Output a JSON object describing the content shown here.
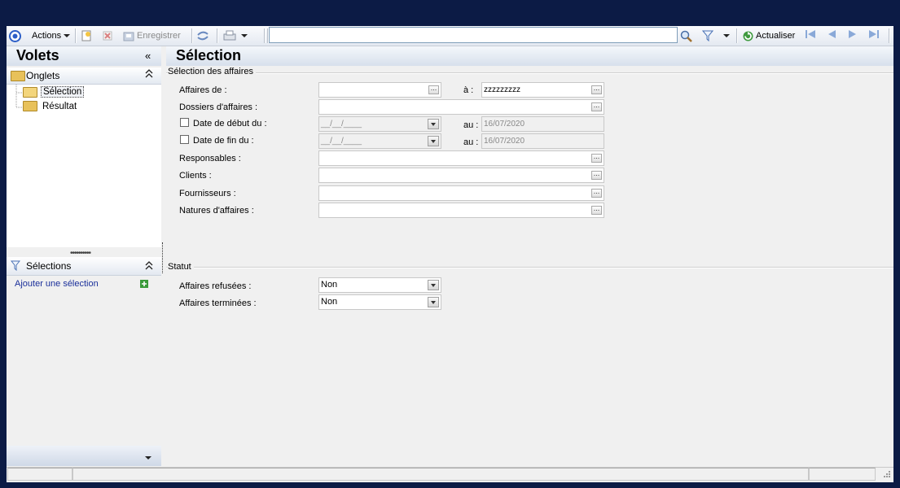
{
  "toolbar": {
    "actions_label": "Actions",
    "save_label": "Enregistrer",
    "refresh_label": "Actualiser",
    "search_value": ""
  },
  "left_panel": {
    "title": "Volets",
    "collapse_glyph": "«",
    "onglets_label": "Onglets",
    "tree": [
      {
        "label": "Sélection",
        "selected": true
      },
      {
        "label": "Résultat",
        "selected": false
      }
    ],
    "selections_label": "Sélections",
    "add_selection_label": "Ajouter une sélection"
  },
  "main": {
    "title": "Sélection",
    "group_affaires": "Sélection des affaires",
    "affaires_de_label": "Affaires de :",
    "affaires_de_value": "",
    "a_label": "à :",
    "a_value": "zzzzzzzzz",
    "dossiers_label": "Dossiers d'affaires :",
    "date_debut_label": "Date de début du :",
    "date_debut_value": "__/__/____",
    "au_label": "au :",
    "date_debut_au_value": "16/07/2020",
    "date_fin_label": "Date de fin du :",
    "date_fin_value": "__/__/____",
    "date_fin_au_value": "16/07/2020",
    "responsables_label": "Responsables :",
    "clients_label": "Clients :",
    "fournisseurs_label": "Fournisseurs :",
    "natures_label": "Natures d'affaires :",
    "group_statut": "Statut",
    "refusees_label": "Affaires refusées :",
    "refusees_value": "Non",
    "terminees_label": "Affaires terminées :",
    "terminees_value": "Non"
  },
  "colors": {
    "background": "#0c1b45",
    "link": "#1a2f9a",
    "header_gradient_end": "#d7e0ec"
  }
}
